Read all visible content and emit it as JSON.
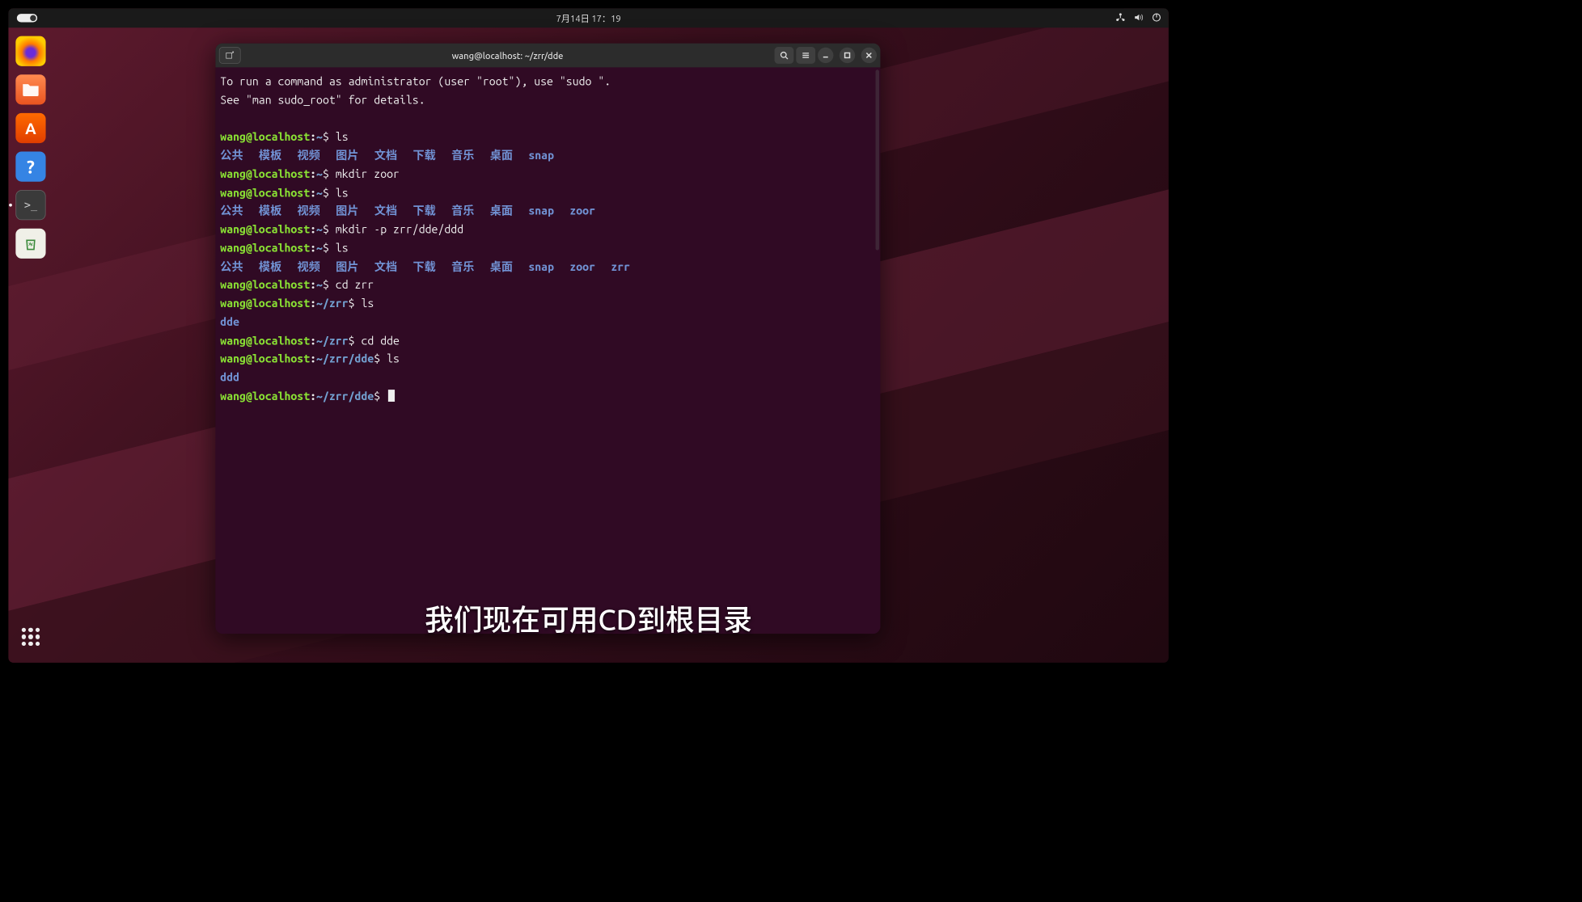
{
  "topbar": {
    "clock": "7月14日 17：19"
  },
  "dock": {
    "items": [
      {
        "name": "firefox",
        "label": "Firefox"
      },
      {
        "name": "files",
        "label": "Files"
      },
      {
        "name": "software",
        "label": "Ubuntu Software"
      },
      {
        "name": "help",
        "label": "Help"
      },
      {
        "name": "terminal",
        "label": "Terminal"
      },
      {
        "name": "trash",
        "label": "Trash"
      }
    ]
  },
  "terminal": {
    "title": "wang@localhost: ~/zrr/dde",
    "user": "wang",
    "host": "localhost",
    "motd1": "To run a command as administrator (user \"root\"), use \"sudo <command>\".",
    "motd2": "See \"man sudo_root\" for details.",
    "history": [
      {
        "path": "~",
        "cmd": "ls"
      },
      {
        "type": "dirs",
        "items": [
          "公共",
          "模板",
          "视频",
          "图片",
          "文档",
          "下载",
          "音乐",
          "桌面",
          "snap"
        ]
      },
      {
        "path": "~",
        "cmd": "mkdir zoor"
      },
      {
        "path": "~",
        "cmd": "ls"
      },
      {
        "type": "dirs",
        "items": [
          "公共",
          "模板",
          "视频",
          "图片",
          "文档",
          "下载",
          "音乐",
          "桌面",
          "snap",
          "zoor"
        ]
      },
      {
        "path": "~",
        "cmd": "mkdir -p zrr/dde/ddd"
      },
      {
        "path": "~",
        "cmd": "ls"
      },
      {
        "type": "dirs",
        "items": [
          "公共",
          "模板",
          "视频",
          "图片",
          "文档",
          "下载",
          "音乐",
          "桌面",
          "snap",
          "zoor",
          "zrr"
        ]
      },
      {
        "path": "~",
        "cmd": "cd zrr"
      },
      {
        "path": "~/zrr",
        "cmd": "ls"
      },
      {
        "type": "dirs",
        "items": [
          "dde"
        ]
      },
      {
        "path": "~/zrr",
        "cmd": "cd dde"
      },
      {
        "path": "~/zrr/dde",
        "cmd": "ls"
      },
      {
        "type": "dirs",
        "items": [
          "ddd"
        ]
      },
      {
        "path": "~/zrr/dde",
        "cmd": "",
        "cursor": true
      }
    ]
  },
  "subtitle": "我们现在可用CD到根目录"
}
